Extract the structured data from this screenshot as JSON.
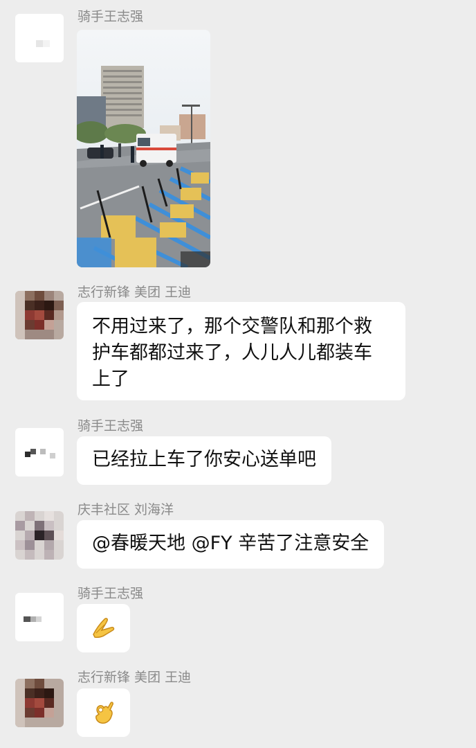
{
  "messages": [
    {
      "sender": "骑手王志强",
      "type": "image",
      "image_alt": "street-bikes-ambulance-photo"
    },
    {
      "sender": "志行新锋 美团 王迪",
      "type": "text",
      "lines": [
        "不用过来了，那个交警队和那个救",
        "护车都都过来了，人儿人儿都装车",
        "上了"
      ]
    },
    {
      "sender": "骑手王志强",
      "type": "text",
      "text": "已经拉上车了你安心送单吧"
    },
    {
      "sender": "庆丰社区 刘海洋",
      "type": "text",
      "text": "@春暖天地 @FY 辛苦了注意安全"
    },
    {
      "sender": "骑手王志强",
      "type": "emoji",
      "emoji_icon": "hand-gesture-emoji"
    },
    {
      "sender": "志行新锋 美团 王迪",
      "type": "emoji",
      "emoji_icon": "ok-hand-emoji"
    }
  ],
  "colors": {
    "background": "#ededed",
    "bubble": "#ffffff",
    "sender_name": "#8a8a8a",
    "text": "#111111"
  }
}
